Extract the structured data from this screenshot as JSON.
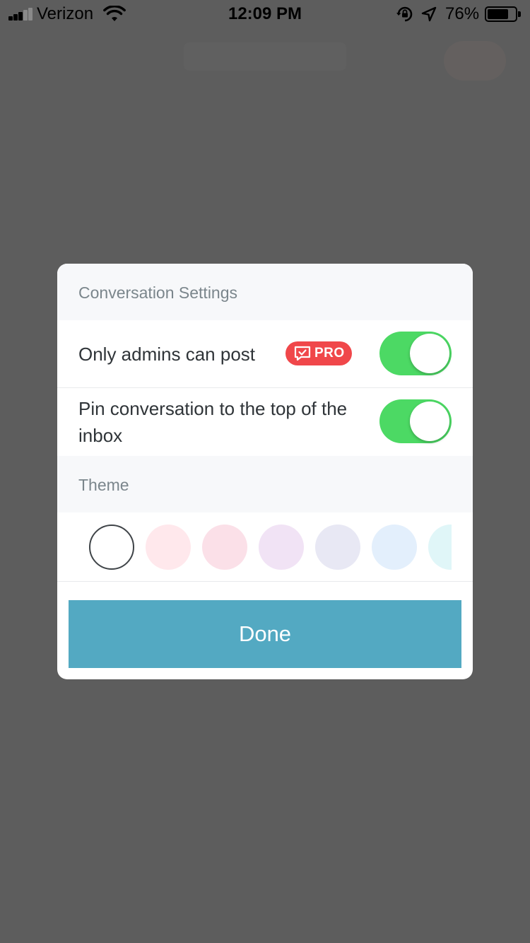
{
  "status_bar": {
    "carrier": "Verizon",
    "time": "12:09 PM",
    "battery_percent": "76%",
    "battery_level": 0.76,
    "signal_bars_active": 3,
    "signal_bars_total": 5,
    "icons": [
      "signal-icon",
      "wifi-icon",
      "rotation-lock-icon",
      "location-arrow-icon",
      "battery-icon"
    ]
  },
  "modal": {
    "title": "Conversation Settings",
    "settings": [
      {
        "label": "Only admins can post",
        "badge": "PRO",
        "enabled": true
      },
      {
        "label": "Pin conversation to the top of the inbox",
        "enabled": true
      }
    ],
    "theme": {
      "title": "Theme",
      "selected_index": 0,
      "swatches": [
        "#ffffff",
        "#ffe8ec",
        "#fbe0e8",
        "#f1e3f5",
        "#e8e8f4",
        "#e3effc",
        "#e0f6f8"
      ]
    },
    "done_label": "Done"
  },
  "colors": {
    "overlay": "#5d5d5d",
    "toggle_on": "#4cd964",
    "pro_badge": "#f0474a",
    "done_button": "#53a9c2",
    "section_header_bg": "#f7f8fa",
    "section_header_text": "#7b868c"
  }
}
